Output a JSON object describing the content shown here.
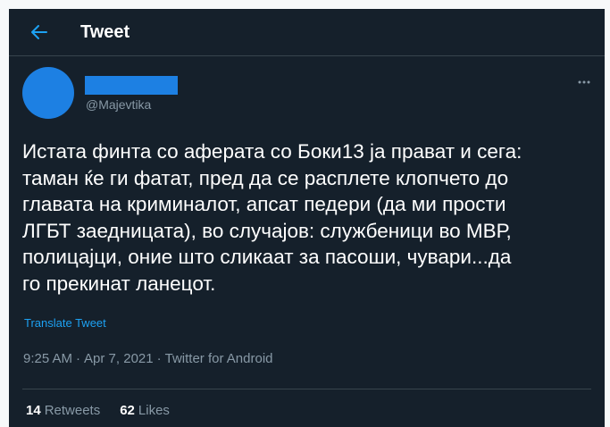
{
  "header": {
    "title": "Tweet",
    "back_icon": "arrow-left-icon"
  },
  "author": {
    "handle": "@Majevtika",
    "more_icon": "more-horizontal-icon"
  },
  "tweet": {
    "text": "Истата финта со аферата со Боки13 ја прават и сега:\nтаман ќе ги фатат, пред да се расплете клопчето до\nглавата на криминалот, апсат педери (да ми прости\nЛГБТ заедницата), во случајов: службеници во МВР,\nполицајци, оние што сликаат за пасоши, чувари...да\nго прекинат ланецот.",
    "translate_label": "Translate Tweet"
  },
  "meta": {
    "time": "9:25 AM",
    "separator_1": "·",
    "date": "Apr 7, 2021",
    "separator_2": "·",
    "source": "Twitter for Android"
  },
  "stats": {
    "retweets_count": "14",
    "retweets_label": "Retweets",
    "likes_count": "62",
    "likes_label": "Likes"
  },
  "colors": {
    "background": "#15202b",
    "accent": "#1da1f2",
    "avatar": "#1d80e3",
    "muted_text": "#8899a6",
    "border": "#38444d"
  }
}
